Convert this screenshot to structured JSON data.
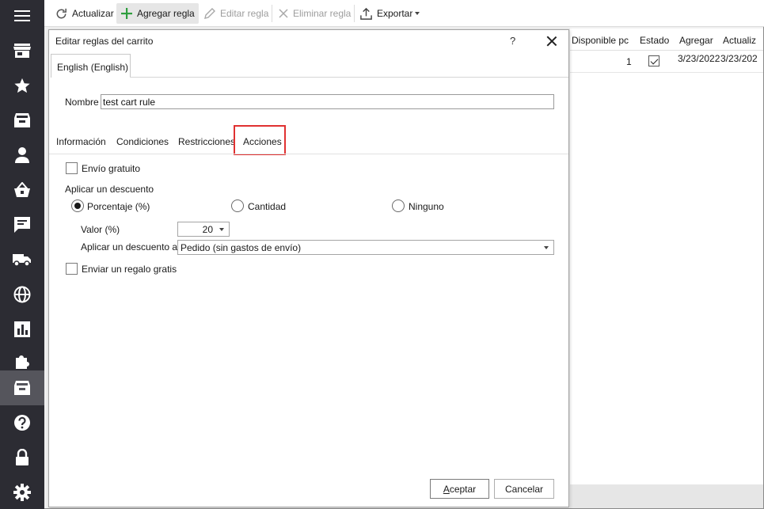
{
  "toolbar": {
    "refresh": "Actualizar",
    "add_rule": "Agregar regla",
    "edit_rule": "Editar regla",
    "delete_rule": "Eliminar regla",
    "export": "Exportar"
  },
  "grid": {
    "columns": [
      "Disponible pc",
      "Estado",
      "Agregar",
      "Actualiz"
    ],
    "row": {
      "available": "1",
      "status_checked": true,
      "added": "3/23/2022",
      "updated": "3/23/202"
    }
  },
  "dialog": {
    "title": "Editar reglas del carrito",
    "help": "?",
    "language_tab": "English (English)",
    "name_label": "Nombre",
    "name_value": "test cart rule",
    "tabs": [
      "Información",
      "Condiciones",
      "Restricciones",
      "Acciones"
    ],
    "selected_tab": "Acciones",
    "free_shipping": {
      "label": "Envío gratuito",
      "checked": false
    },
    "apply_discount_label": "Aplicar un descuento",
    "discount_options": [
      {
        "label": "Porcentaje (%)",
        "selected": true
      },
      {
        "label": "Cantidad",
        "selected": false
      },
      {
        "label": "Ninguno",
        "selected": false
      }
    ],
    "value_label": "Valor (%)",
    "value": "20",
    "apply_to_label": "Aplicar un descuento a",
    "apply_to_value": "Pedido (sin gastos de envío)",
    "free_gift": {
      "label": "Enviar un regalo gratis",
      "checked": false
    },
    "accept_hotkey": "A",
    "accept_rest": "ceptar",
    "cancel": "Cancelar"
  },
  "colors": {
    "sidebar_bg": "#2c2c33",
    "sidebar_active": "#55555c",
    "highlight_border": "#e03131",
    "add_icon": "#2e9e3e"
  }
}
